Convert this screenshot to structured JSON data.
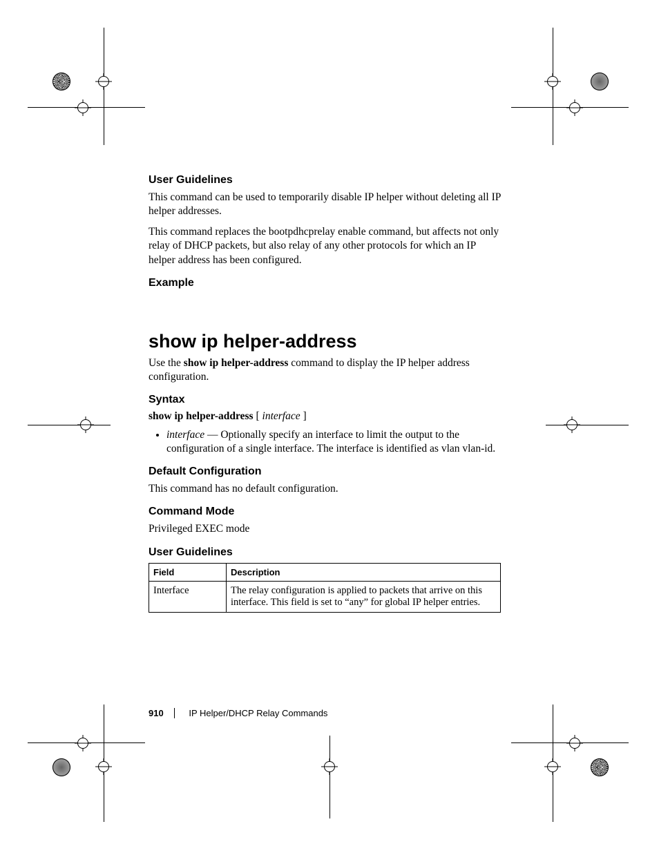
{
  "sections": {
    "ug1": {
      "heading": "User Guidelines",
      "p1": "This command can be used to temporarily disable IP helper without deleting all IP helper addresses.",
      "p2": "This command replaces the bootpdhcprelay enable command, but affects not only relay of DHCP packets, but also relay of any other protocols for which an IP helper address has been configured."
    },
    "example": {
      "heading": "Example"
    },
    "cmd": {
      "title": "show ip helper-address",
      "intro_pre": "Use the ",
      "intro_bold": "show ip helper-address",
      "intro_post": " command to display the IP helper address configuration."
    },
    "syntax": {
      "heading": "Syntax",
      "bold": "show ip helper-address",
      "bracket_open": " [ ",
      "ital": "interface",
      "bracket_close": " ]",
      "bullet_term": "interface",
      "bullet_rest": " — Optionally specify an interface to limit the output to the configuration of a single interface. The interface is identified as vlan vlan-id."
    },
    "defcfg": {
      "heading": "Default Configuration",
      "p": "This command has no default configuration."
    },
    "mode": {
      "heading": "Command Mode",
      "p": "Privileged EXEC mode"
    },
    "ug2": {
      "heading": "User Guidelines"
    },
    "table": {
      "h1": "Field",
      "h2": "Description",
      "r1c1": "Interface",
      "r1c2": "The relay configuration is applied to packets that arrive on this interface. This field is set to “any” for global IP helper entries."
    }
  },
  "footer": {
    "page": "910",
    "chapter": "IP Helper/DHCP Relay Commands"
  }
}
